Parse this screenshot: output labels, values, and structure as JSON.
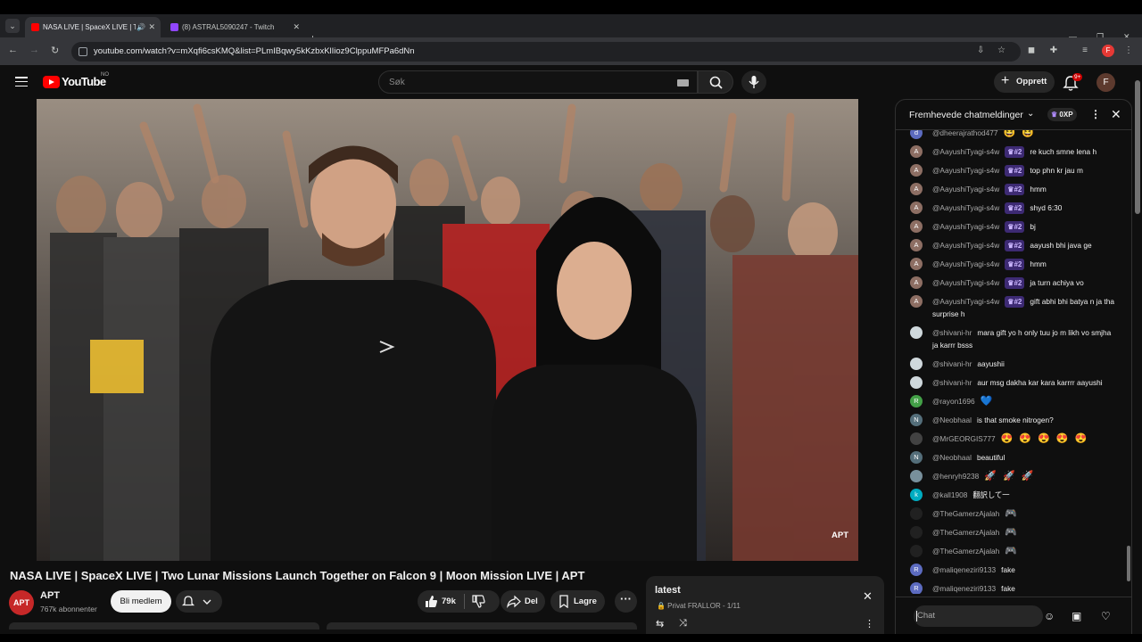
{
  "browser": {
    "tabs": [
      {
        "title": "NASA LIVE | SpaceX LIVE | T",
        "extra": "🔊",
        "favicon_color": "#ff0000"
      },
      {
        "title": "(8) ASTRAL5090247 - Twitch",
        "extra": "",
        "favicon_color": "#9146ff"
      }
    ],
    "url": "youtube.com/watch?v=mXqfi6csKMQ&list=PLmIBqwy5kKzbxKlIioz9ClppuMFPa6dNn",
    "profile_initial": "F"
  },
  "masthead": {
    "logo_text": "YouTube",
    "country_code": "NO",
    "search_placeholder": "Søk",
    "create_label": "Opprett",
    "notification_count": "9+",
    "avatar_initial": "F"
  },
  "video": {
    "title": "NASA LIVE | SpaceX LIVE | Two Lunar Missions Launch Together on Falcon 9 | Moon Mission LIVE | APT",
    "watermark": "APT"
  },
  "channel": {
    "name": "APT",
    "subscribers": "767k abonnenter",
    "avatar_text": "APT",
    "join_label": "Bli medlem"
  },
  "actions": {
    "likes": "79k",
    "share_label": "Del",
    "save_label": "Lagre"
  },
  "playlist": {
    "title": "latest",
    "meta": "🔒 Privat FRALLOR - 1/11"
  },
  "chat": {
    "header_title": "Fremhevede chatmeldinger",
    "xp_label": "0XP",
    "input_placeholder": "Chat",
    "messages": [
      {
        "author": "@dheerajrathod477",
        "badge": "",
        "text": "",
        "emoji": "😆 😆",
        "avatar": "d",
        "avatar_color": "#5c6bc0"
      },
      {
        "author": "@AayushiTyagi-s4w",
        "badge": "♛#2",
        "text": "re kuch smne lena h",
        "emoji": "",
        "avatar": "A",
        "avatar_color": "#8d6e63"
      },
      {
        "author": "@AayushiTyagi-s4w",
        "badge": "♛#2",
        "text": "top phn kr jau m",
        "emoji": "",
        "avatar": "A",
        "avatar_color": "#8d6e63"
      },
      {
        "author": "@AayushiTyagi-s4w",
        "badge": "♛#2",
        "text": "hmm",
        "emoji": "",
        "avatar": "A",
        "avatar_color": "#8d6e63"
      },
      {
        "author": "@AayushiTyagi-s4w",
        "badge": "♛#2",
        "text": "shyd 6:30",
        "emoji": "",
        "avatar": "A",
        "avatar_color": "#8d6e63"
      },
      {
        "author": "@AayushiTyagi-s4w",
        "badge": "♛#2",
        "text": "bj",
        "emoji": "",
        "avatar": "A",
        "avatar_color": "#8d6e63"
      },
      {
        "author": "@AayushiTyagi-s4w",
        "badge": "♛#2",
        "text": "aayush bhi java ge",
        "emoji": "",
        "avatar": "A",
        "avatar_color": "#8d6e63"
      },
      {
        "author": "@AayushiTyagi-s4w",
        "badge": "♛#2",
        "text": "hmm",
        "emoji": "",
        "avatar": "A",
        "avatar_color": "#8d6e63"
      },
      {
        "author": "@AayushiTyagi-s4w",
        "badge": "♛#2",
        "text": "ja turn achiya vo",
        "emoji": "",
        "avatar": "A",
        "avatar_color": "#8d6e63"
      },
      {
        "author": "@AayushiTyagi-s4w",
        "badge": "♛#2",
        "text": "gift abhi bhi batya n ja tha surprise h",
        "emoji": "",
        "avatar": "A",
        "avatar_color": "#8d6e63"
      },
      {
        "author": "@shivani-hr",
        "badge": "",
        "text": "mara gift yo h only tuu jo m likh vo smjha ja karrr bsss",
        "emoji": "",
        "avatar": "",
        "avatar_color": "#cfd8dc"
      },
      {
        "author": "@shivani-hr",
        "badge": "",
        "text": "aayushii",
        "emoji": "",
        "avatar": "",
        "avatar_color": "#cfd8dc"
      },
      {
        "author": "@shivani-hr",
        "badge": "",
        "text": "aur msg dakha kar kara karrrr aayushi",
        "emoji": "",
        "avatar": "",
        "avatar_color": "#cfd8dc"
      },
      {
        "author": "@rayon1696",
        "badge": "",
        "text": "",
        "emoji": "💙",
        "avatar": "R",
        "avatar_color": "#43a047"
      },
      {
        "author": "@Neobhaal",
        "badge": "",
        "text": "is that smoke nitrogen?",
        "emoji": "",
        "avatar": "N",
        "avatar_color": "#546e7a"
      },
      {
        "author": "@MrGEORGIS777",
        "badge": "",
        "text": "",
        "emoji": "😍 😍 😍 😍 😍",
        "avatar": "",
        "avatar_color": "#424242"
      },
      {
        "author": "@Neobhaal",
        "badge": "",
        "text": "beautiful",
        "emoji": "",
        "avatar": "N",
        "avatar_color": "#546e7a"
      },
      {
        "author": "@henryh9238",
        "badge": "",
        "text": "",
        "emoji": "🚀 🚀 🚀",
        "avatar": "",
        "avatar_color": "#78909c"
      },
      {
        "author": "@kall1908",
        "badge": "",
        "text": "翻訳して一",
        "emoji": "",
        "avatar": "k",
        "avatar_color": "#00acc1"
      },
      {
        "author": "@TheGamerzAjalah",
        "badge": "",
        "text": "",
        "emoji": "🎮",
        "avatar": "",
        "avatar_color": "#212121"
      },
      {
        "author": "@TheGamerzAjalah",
        "badge": "",
        "text": "",
        "emoji": "🎮",
        "avatar": "",
        "avatar_color": "#212121"
      },
      {
        "author": "@TheGamerzAjalah",
        "badge": "",
        "text": "",
        "emoji": "🎮",
        "avatar": "",
        "avatar_color": "#212121"
      },
      {
        "author": "@maliqeneziri9133",
        "badge": "",
        "text": "fake",
        "emoji": "",
        "avatar": "R",
        "avatar_color": "#5c6bc0"
      },
      {
        "author": "@maliqeneziri9133",
        "badge": "",
        "text": "fake",
        "emoji": "",
        "avatar": "R",
        "avatar_color": "#5c6bc0"
      }
    ]
  }
}
